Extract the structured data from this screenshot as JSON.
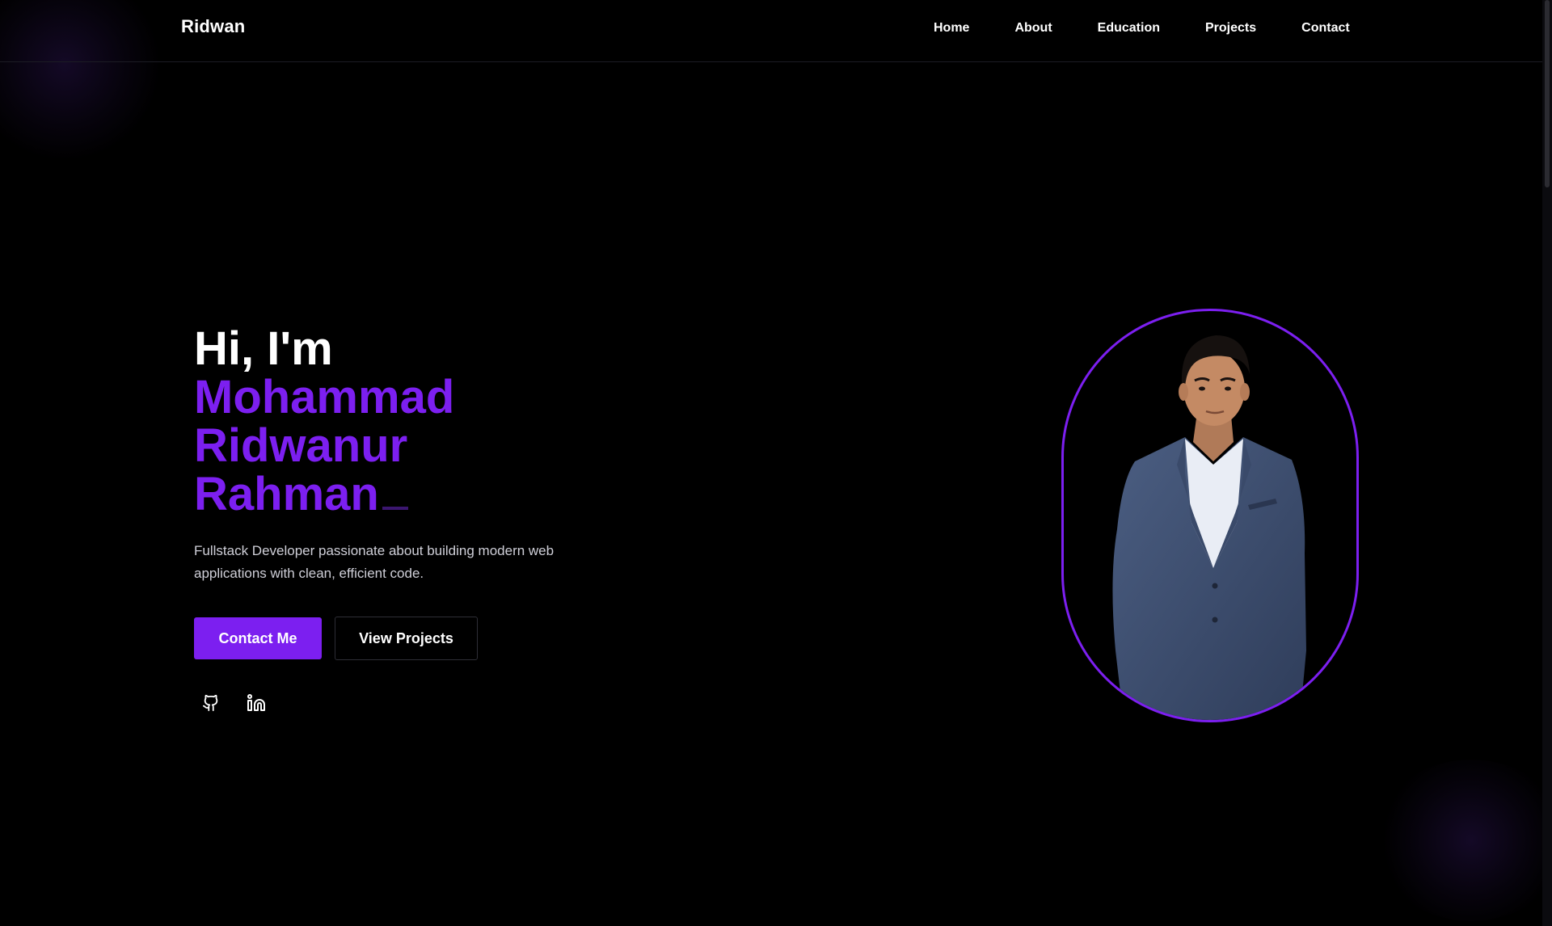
{
  "brand": "Ridwan",
  "nav": {
    "home": "Home",
    "about": "About",
    "education": "Education",
    "projects": "Projects",
    "contact": "Contact"
  },
  "hero": {
    "greeting": "Hi, I'm",
    "name_line_1": "Mohammad",
    "name_line_2": "Ridwanur",
    "name_line_3": "Rahman",
    "tagline": "Fullstack Developer passionate about building modern web applications with clean, efficient code.",
    "primary_button": "Contact Me",
    "secondary_button": "View Projects"
  },
  "socials": {
    "github_icon": "github-icon",
    "linkedin_icon": "linkedin-icon"
  },
  "colors": {
    "accent": "#7c1ff0",
    "background": "#000000",
    "text": "#ffffff",
    "muted_text": "#cfcfd8",
    "suit": "#3d4f70"
  }
}
